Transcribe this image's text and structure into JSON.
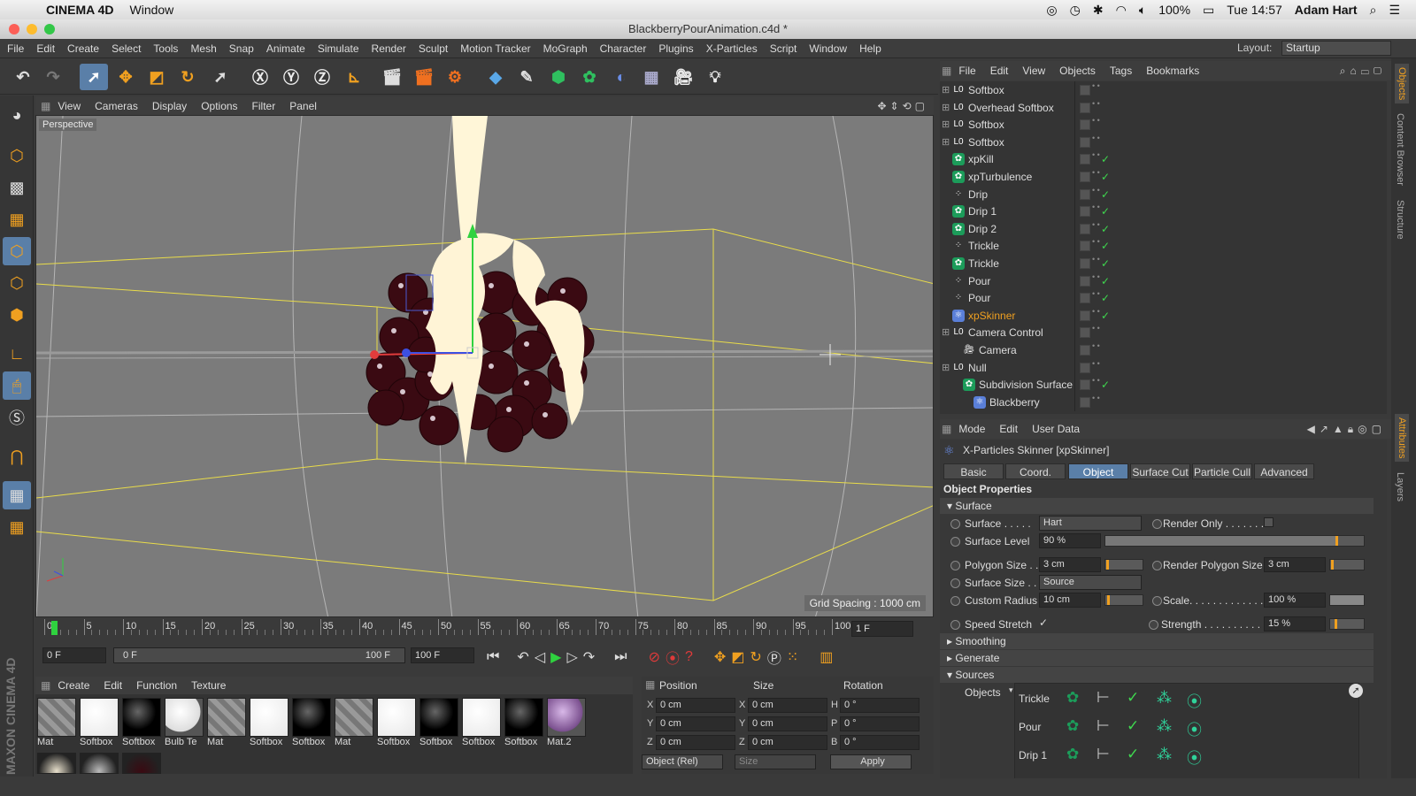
{
  "mac_menubar": {
    "app_name": "CINEMA 4D",
    "menu": "Window",
    "battery": "100%",
    "clock": "Tue 14:57",
    "user": "Adam Hart"
  },
  "window": {
    "title": "BlackberryPourAnimation.c4d *"
  },
  "main_menu": [
    "File",
    "Edit",
    "Create",
    "Select",
    "Tools",
    "Mesh",
    "Snap",
    "Animate",
    "Simulate",
    "Render",
    "Sculpt",
    "Motion Tracker",
    "MoGraph",
    "Character",
    "Plugins",
    "X-Particles",
    "Script",
    "Window",
    "Help"
  ],
  "layout": {
    "label": "Layout:",
    "value": "Startup"
  },
  "viewport": {
    "menu": [
      "View",
      "Cameras",
      "Display",
      "Options",
      "Filter",
      "Panel"
    ],
    "label": "Perspective",
    "grid_spacing": "Grid Spacing : 1000 cm"
  },
  "timeline": {
    "ticks": [
      "0",
      "5",
      "10",
      "15",
      "20",
      "25",
      "30",
      "35",
      "40",
      "45",
      "50",
      "55",
      "60",
      "65",
      "70",
      "75",
      "80",
      "85",
      "90",
      "95",
      "100"
    ],
    "frame_display": "1 F",
    "current_frame": "0 F",
    "range_start": "0 F",
    "range_end": "100 F",
    "end_frame": "100 F"
  },
  "material_manager": {
    "menu": [
      "Create",
      "Edit",
      "Function",
      "Texture"
    ],
    "materials": [
      {
        "label": "Mat",
        "kind": "checker"
      },
      {
        "label": "Softbox",
        "kind": "white"
      },
      {
        "label": "Softbox",
        "kind": "black"
      },
      {
        "label": "Bulb Te",
        "kind": "whiteball"
      },
      {
        "label": "Mat",
        "kind": "checker"
      },
      {
        "label": "Softbox",
        "kind": "white"
      },
      {
        "label": "Softbox",
        "kind": "black"
      },
      {
        "label": "Mat",
        "kind": "checker"
      },
      {
        "label": "Softbox",
        "kind": "white"
      },
      {
        "label": "Softbox",
        "kind": "black"
      },
      {
        "label": "Softbox",
        "kind": "white"
      },
      {
        "label": "Softbox",
        "kind": "black"
      },
      {
        "label": "Mat.2",
        "kind": "purple"
      }
    ]
  },
  "coordinates": {
    "headers": [
      "Position",
      "Size",
      "Rotation"
    ],
    "rows": [
      {
        "axis": "X",
        "pos": "0 cm",
        "size_axis": "X",
        "size": "0 cm",
        "rot_axis": "H",
        "rot": "0 °"
      },
      {
        "axis": "Y",
        "pos": "0 cm",
        "size_axis": "Y",
        "size": "0 cm",
        "rot_axis": "P",
        "rot": "0 °"
      },
      {
        "axis": "Z",
        "pos": "0 cm",
        "size_axis": "Z",
        "size": "0 cm",
        "rot_axis": "B",
        "rot": "0 °"
      }
    ],
    "mode": "Object (Rel)",
    "size_mode": "Size",
    "apply": "Apply"
  },
  "object_manager": {
    "menu": [
      "File",
      "Edit",
      "View",
      "Objects",
      "Tags",
      "Bookmarks"
    ],
    "objects": [
      {
        "name": "Softbox",
        "indent": 0,
        "icon": "null",
        "check": false,
        "highlight": false
      },
      {
        "name": "Overhead Softbox",
        "indent": 0,
        "icon": "null",
        "check": false,
        "highlight": false
      },
      {
        "name": "Softbox",
        "indent": 0,
        "icon": "null",
        "check": false,
        "highlight": false
      },
      {
        "name": "Softbox",
        "indent": 0,
        "icon": "null",
        "check": false,
        "highlight": false
      },
      {
        "name": "xpKill",
        "indent": 0,
        "icon": "green",
        "check": true,
        "highlight": false
      },
      {
        "name": "xpTurbulence",
        "indent": 0,
        "icon": "green",
        "check": true,
        "highlight": false
      },
      {
        "name": "Drip",
        "indent": 0,
        "icon": "emitter",
        "check": true,
        "highlight": false
      },
      {
        "name": "Drip 1",
        "indent": 0,
        "icon": "green",
        "check": true,
        "highlight": false
      },
      {
        "name": "Drip 2",
        "indent": 0,
        "icon": "green",
        "check": true,
        "highlight": false
      },
      {
        "name": "Trickle",
        "indent": 0,
        "icon": "emitter",
        "check": true,
        "highlight": false
      },
      {
        "name": "Trickle",
        "indent": 0,
        "icon": "green",
        "check": true,
        "highlight": false
      },
      {
        "name": "Pour",
        "indent": 0,
        "icon": "emitter",
        "check": true,
        "highlight": false
      },
      {
        "name": "Pour",
        "indent": 0,
        "icon": "emitter",
        "check": true,
        "highlight": false
      },
      {
        "name": "xpSkinner",
        "indent": 0,
        "icon": "blue",
        "check": true,
        "highlight": true
      },
      {
        "name": "Camera Control",
        "indent": 0,
        "icon": "null",
        "check": false,
        "highlight": false
      },
      {
        "name": "Camera",
        "indent": 1,
        "icon": "camera",
        "check": false,
        "highlight": false
      },
      {
        "name": "Null",
        "indent": 0,
        "icon": "null",
        "check": false,
        "highlight": false
      },
      {
        "name": "Subdivision Surface",
        "indent": 1,
        "icon": "green",
        "check": true,
        "highlight": false
      },
      {
        "name": "Blackberry",
        "indent": 2,
        "icon": "blue",
        "check": false,
        "highlight": false
      }
    ]
  },
  "side_tabs": {
    "top": [
      "Objects",
      "Content Browser",
      "Structure"
    ],
    "bottom": [
      "Attributes",
      "Layers"
    ]
  },
  "attributes": {
    "menu": [
      "Mode",
      "Edit",
      "User Data"
    ],
    "object_title": "X-Particles Skinner [xpSkinner]",
    "tabs": [
      "Basic",
      "Coord.",
      "Object",
      "Surface Cut",
      "Particle Cull",
      "Advanced"
    ],
    "active_tab": "Object",
    "section_title": "Object Properties",
    "groups": {
      "surface": "Surface",
      "smoothing": "Smoothing",
      "generate": "Generate",
      "sources": "Sources"
    },
    "params": {
      "surface_label": "Surface . . . . .",
      "surface_value": "Hart",
      "render_only_label": "Render Only . . . . . . .",
      "surface_level_label": "Surface Level",
      "surface_level_value": "90 %",
      "surface_level_fraction": 0.9,
      "polygon_size_label": "Polygon Size . .",
      "polygon_size_value": "3 cm",
      "render_polygon_size_label": "Render Polygon Size",
      "render_polygon_size_value": "3 cm",
      "surface_size_label": "Surface Size . .",
      "surface_size_value": "Source",
      "custom_radius_label": "Custom Radius",
      "custom_radius_value": "10 cm",
      "scale_label": "Scale. . . . . . . . . . . . .",
      "scale_value": "100 %",
      "speed_stretch_label": "Speed Stretch",
      "strength_label": "Strength . . . . . . . . . .",
      "strength_value": "15 %"
    },
    "sources_label": "Objects",
    "sources": [
      "Trickle",
      "Pour",
      "Drip 1"
    ]
  },
  "brand": "MAXON CINEMA 4D"
}
